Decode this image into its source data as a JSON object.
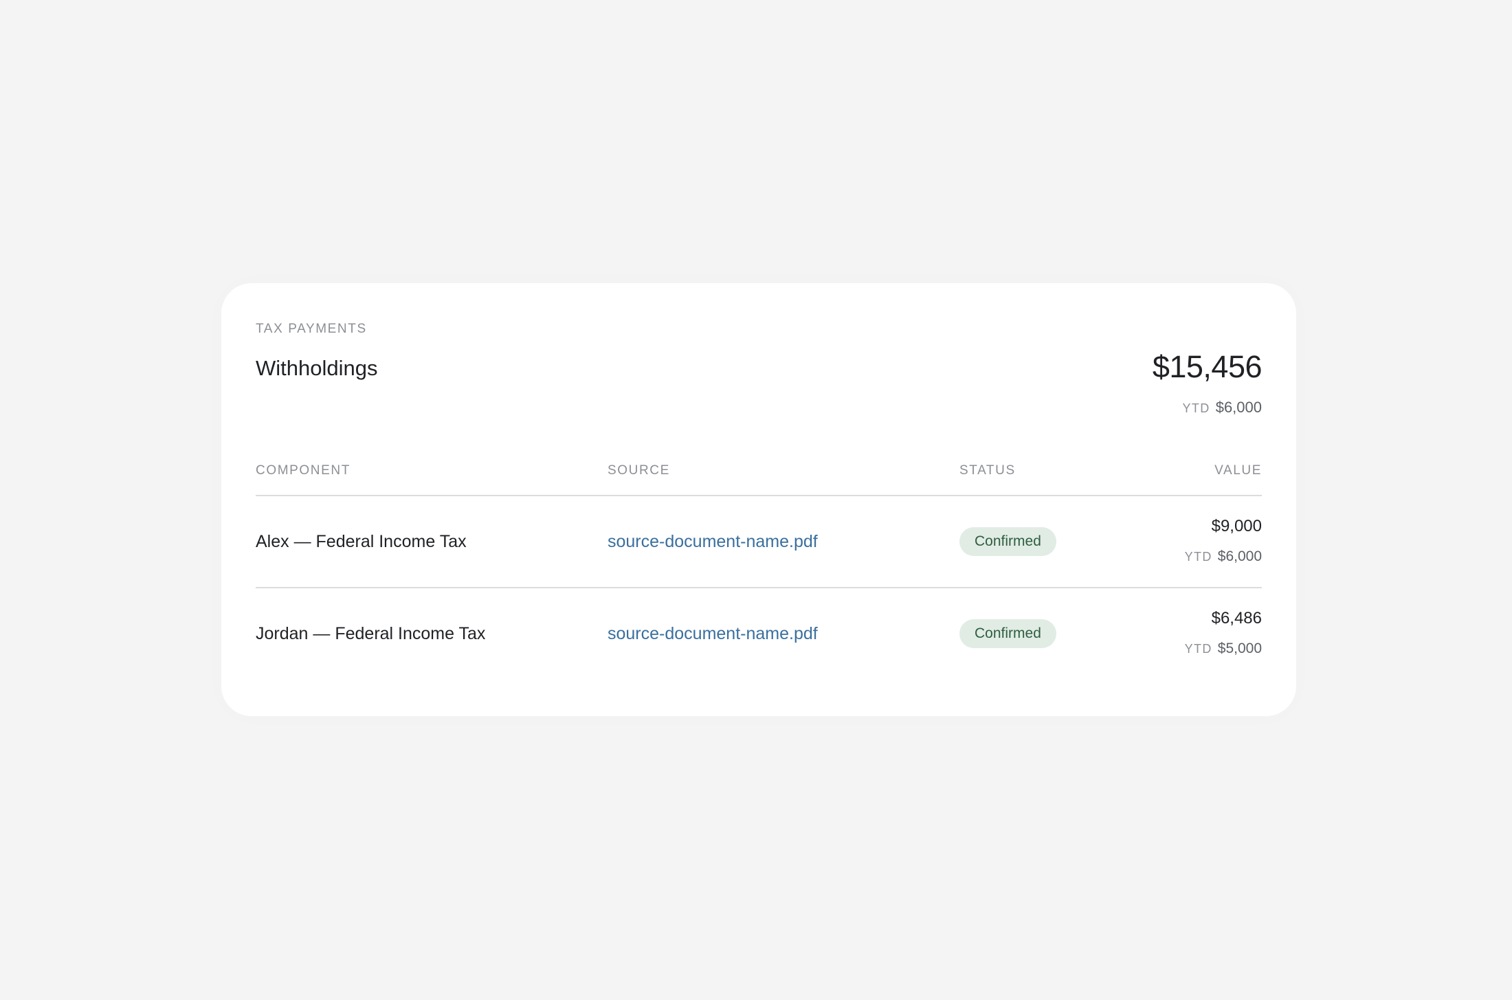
{
  "card": {
    "eyebrow": "TAX PAYMENTS",
    "title": "Withholdings",
    "total": "$15,456",
    "total_ytd_label": "YTD",
    "total_ytd_value": "$6,000"
  },
  "table": {
    "columns": [
      "COMPONENT",
      "SOURCE",
      "STATUS",
      "VALUE"
    ],
    "rows": [
      {
        "component": "Alex — Federal Income Tax",
        "source": "source-document-name.pdf",
        "status": "Confirmed",
        "value": "$9,000",
        "ytd_label": "YTD",
        "ytd_value": "$6,000"
      },
      {
        "component": "Jordan — Federal Income Tax",
        "source": "source-document-name.pdf",
        "status": "Confirmed",
        "value": "$6,486",
        "ytd_label": "YTD",
        "ytd_value": "$5,000"
      }
    ]
  },
  "colors": {
    "background": "#f4f4f4",
    "card": "#ffffff",
    "link": "#3a6f9e",
    "badge_bg": "#e1ece5",
    "badge_text": "#2f5e3e"
  }
}
